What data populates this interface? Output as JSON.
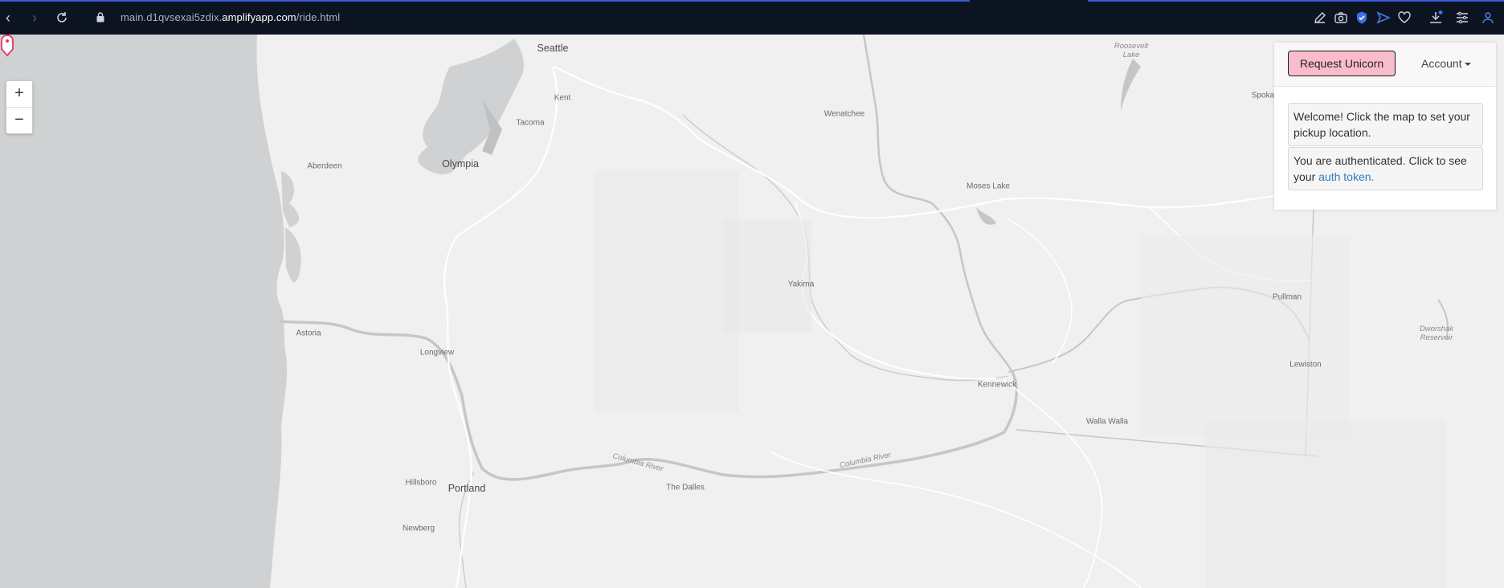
{
  "browser": {
    "url_prefix": "main.d1qvsexai5zdix.",
    "url_host": "amplifyapp.com",
    "url_path": "/ride.html"
  },
  "map": {
    "zoom_in": "+",
    "zoom_out": "−",
    "cities": [
      {
        "name": "Seattle",
        "size": "big"
      },
      {
        "name": "Kent",
        "size": "small"
      },
      {
        "name": "Tacoma",
        "size": "small"
      },
      {
        "name": "Olympia",
        "size": "big"
      },
      {
        "name": "Aberdeen",
        "size": "small"
      },
      {
        "name": "Wenatchee",
        "size": "small"
      },
      {
        "name": "Moses Lake",
        "size": "small"
      },
      {
        "name": "Yakima",
        "size": "small"
      },
      {
        "name": "Astoria",
        "size": "small"
      },
      {
        "name": "Longview",
        "size": "small"
      },
      {
        "name": "Kennewick",
        "size": "small"
      },
      {
        "name": "Walla Walla",
        "size": "small"
      },
      {
        "name": "Pullman",
        "size": "small"
      },
      {
        "name": "Lewiston",
        "size": "small"
      },
      {
        "name": "Hillsboro",
        "size": "small"
      },
      {
        "name": "Portland",
        "size": "big"
      },
      {
        "name": "The Dalles",
        "size": "small"
      },
      {
        "name": "Newberg",
        "size": "small"
      },
      {
        "name": "Spoka",
        "size": "small"
      }
    ],
    "water_labels": [
      "Columbia River",
      "Columbia River",
      "Roosevelt\nLake",
      "Dworshak\nReservoir"
    ]
  },
  "panel": {
    "request_button": "Request Unicorn",
    "account_menu": "Account",
    "welcome_message": "Welcome! Click the map to set your pickup location.",
    "auth_message_prefix": "You are authenticated. Click to see your ",
    "auth_link": "auth token."
  }
}
